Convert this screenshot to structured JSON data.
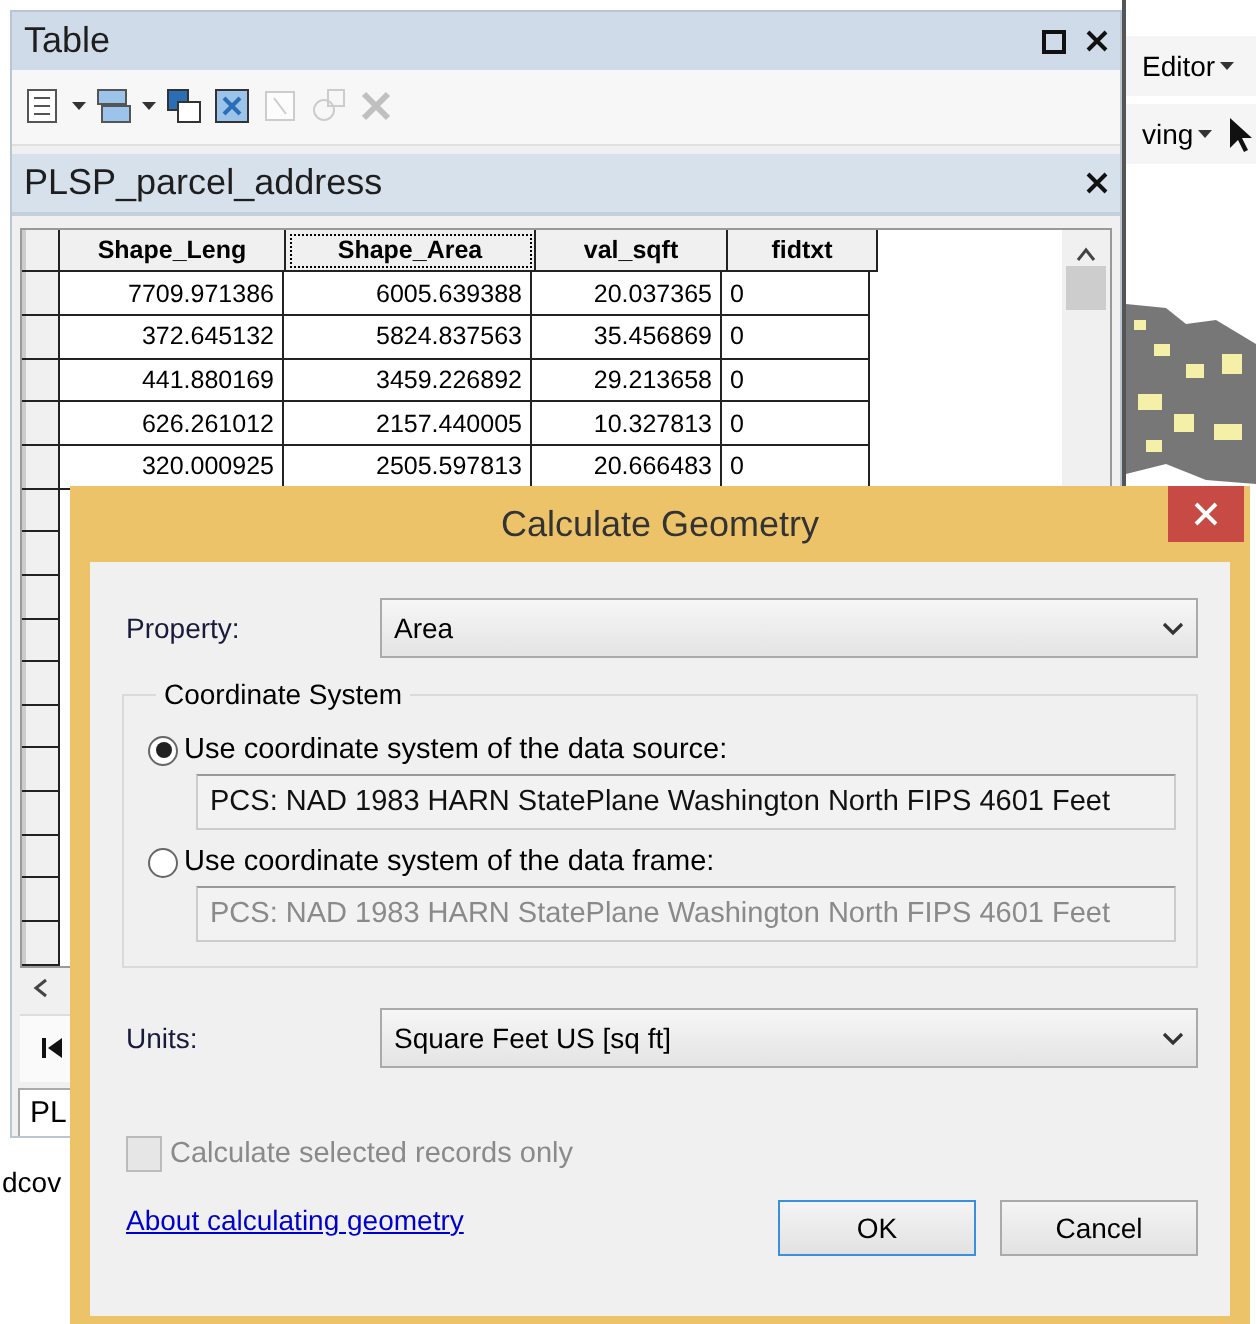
{
  "table_window": {
    "title": "Table",
    "toolbar": [
      {
        "kind": "options",
        "dropdown": true,
        "disabled": false
      },
      {
        "kind": "related",
        "dropdown": true,
        "disabled": false
      },
      {
        "kind": "select",
        "dropdown": false,
        "disabled": false
      },
      {
        "kind": "switch",
        "dropdown": false,
        "disabled": false
      },
      {
        "kind": "clear",
        "dropdown": false,
        "disabled": true
      },
      {
        "kind": "zoom",
        "dropdown": false,
        "disabled": true
      },
      {
        "kind": "delete",
        "dropdown": false,
        "disabled": true
      }
    ],
    "table_name": "PLSP_parcel_address",
    "columns": [
      {
        "label": "Shape_Leng",
        "selected": false,
        "kind": "number"
      },
      {
        "label": "Shape_Area",
        "selected": true,
        "kind": "number"
      },
      {
        "label": "val_sqft",
        "selected": false,
        "kind": "number"
      },
      {
        "label": "fidtxt",
        "selected": false,
        "kind": "text"
      }
    ],
    "rows": [
      [
        "7709.971386",
        "6005.639388",
        "20.037365",
        "0"
      ],
      [
        "372.645132",
        "5824.837563",
        "35.456869",
        "0"
      ],
      [
        "441.880169",
        "3459.226892",
        "29.213658",
        "0"
      ],
      [
        "626.261012",
        "2157.440005",
        "10.327813",
        "0"
      ],
      [
        "320.000925",
        "2505.597813",
        "20.666483",
        "0"
      ]
    ],
    "tab": "PL"
  },
  "map_window": {
    "menus": [
      "Editor",
      "ving"
    ],
    "status_text": "dcov"
  },
  "dialog": {
    "title": "Calculate Geometry",
    "property": {
      "label": "Property:",
      "value": "Area"
    },
    "group_title": "Coordinate System",
    "options": [
      {
        "label": "Use coordinate system of the data source:",
        "selected": true,
        "value": "PCS: NAD 1983 HARN StatePlane Washington North FIPS 4601 Feet"
      },
      {
        "label": "Use coordinate system of the data frame:",
        "selected": false,
        "value": "PCS: NAD 1983 HARN StatePlane Washington North FIPS 4601 Feet"
      }
    ],
    "units": {
      "label": "Units:",
      "value": "Square Feet US [sq ft]"
    },
    "checkbox": {
      "label": "Calculate selected records only",
      "checked": false,
      "disabled": true
    },
    "link": "About calculating geometry",
    "buttons": [
      {
        "label": "OK",
        "default": true
      },
      {
        "label": "Cancel",
        "default": false
      }
    ]
  }
}
